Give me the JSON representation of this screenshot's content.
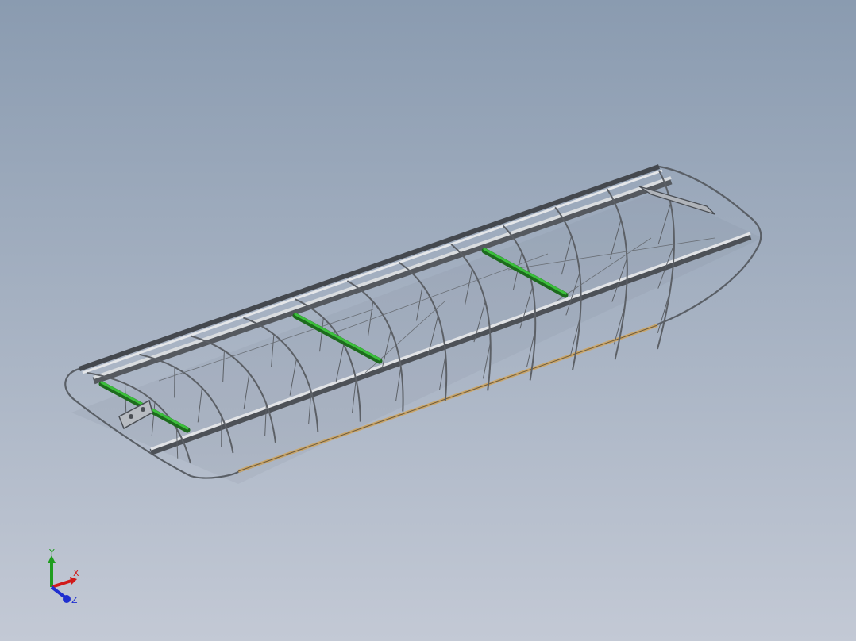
{
  "viewport": {
    "background_top": "#8a9bb0",
    "background_bottom": "#c3c9d5",
    "model": "wing-structure-assembly",
    "rib_color": "#9da1a6",
    "spar_color": "#d9dcdf",
    "tube_color": "#2e9a2e",
    "edge_strip_color": "#c9a66b"
  },
  "triad": {
    "x_label": "X",
    "y_label": "Y",
    "z_label": "Z",
    "x_color": "#d11a1a",
    "y_color": "#1f9d1f",
    "z_color": "#1f2fd0"
  }
}
